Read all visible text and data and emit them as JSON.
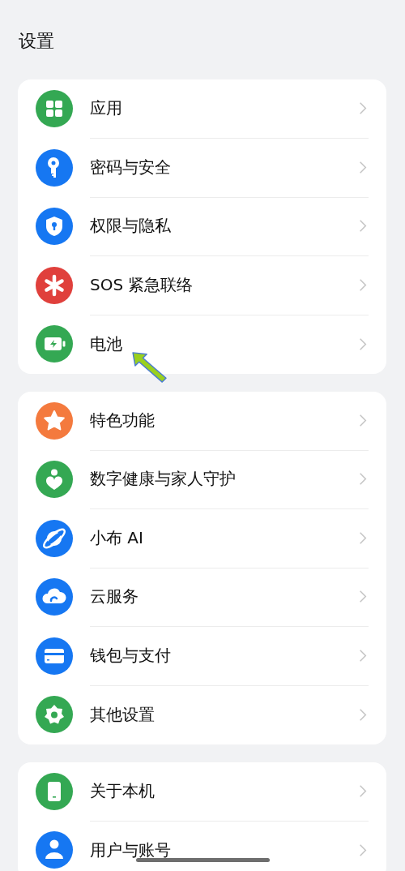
{
  "title": "设置",
  "groups": [
    {
      "items": [
        {
          "label": "应用",
          "color": "#34a853",
          "pointed": false
        },
        {
          "label": "密码与安全",
          "color": "#1677f2",
          "pointed": false
        },
        {
          "label": "权限与隐私",
          "color": "#1677f2",
          "pointed": false
        },
        {
          "label": "SOS 紧急联络",
          "color": "#e0403c",
          "pointed": false
        },
        {
          "label": "电池",
          "color": "#34a853",
          "pointed": true
        }
      ]
    },
    {
      "items": [
        {
          "label": "特色功能",
          "color": "#f47a3e",
          "pointed": false
        },
        {
          "label": "数字健康与家人守护",
          "color": "#34a853",
          "pointed": false
        },
        {
          "label": "小布 AI",
          "color": "#1677f2",
          "pointed": false
        },
        {
          "label": "云服务",
          "color": "#1677f2",
          "pointed": false
        },
        {
          "label": "钱包与支付",
          "color": "#1677f2",
          "pointed": false
        },
        {
          "label": "其他设置",
          "color": "#34a853",
          "pointed": false
        }
      ]
    },
    {
      "items": [
        {
          "label": "关于本机",
          "color": "#34a853",
          "pointed": false
        },
        {
          "label": "用户与账号",
          "color": "#1677f2",
          "pointed": false
        }
      ]
    }
  ]
}
